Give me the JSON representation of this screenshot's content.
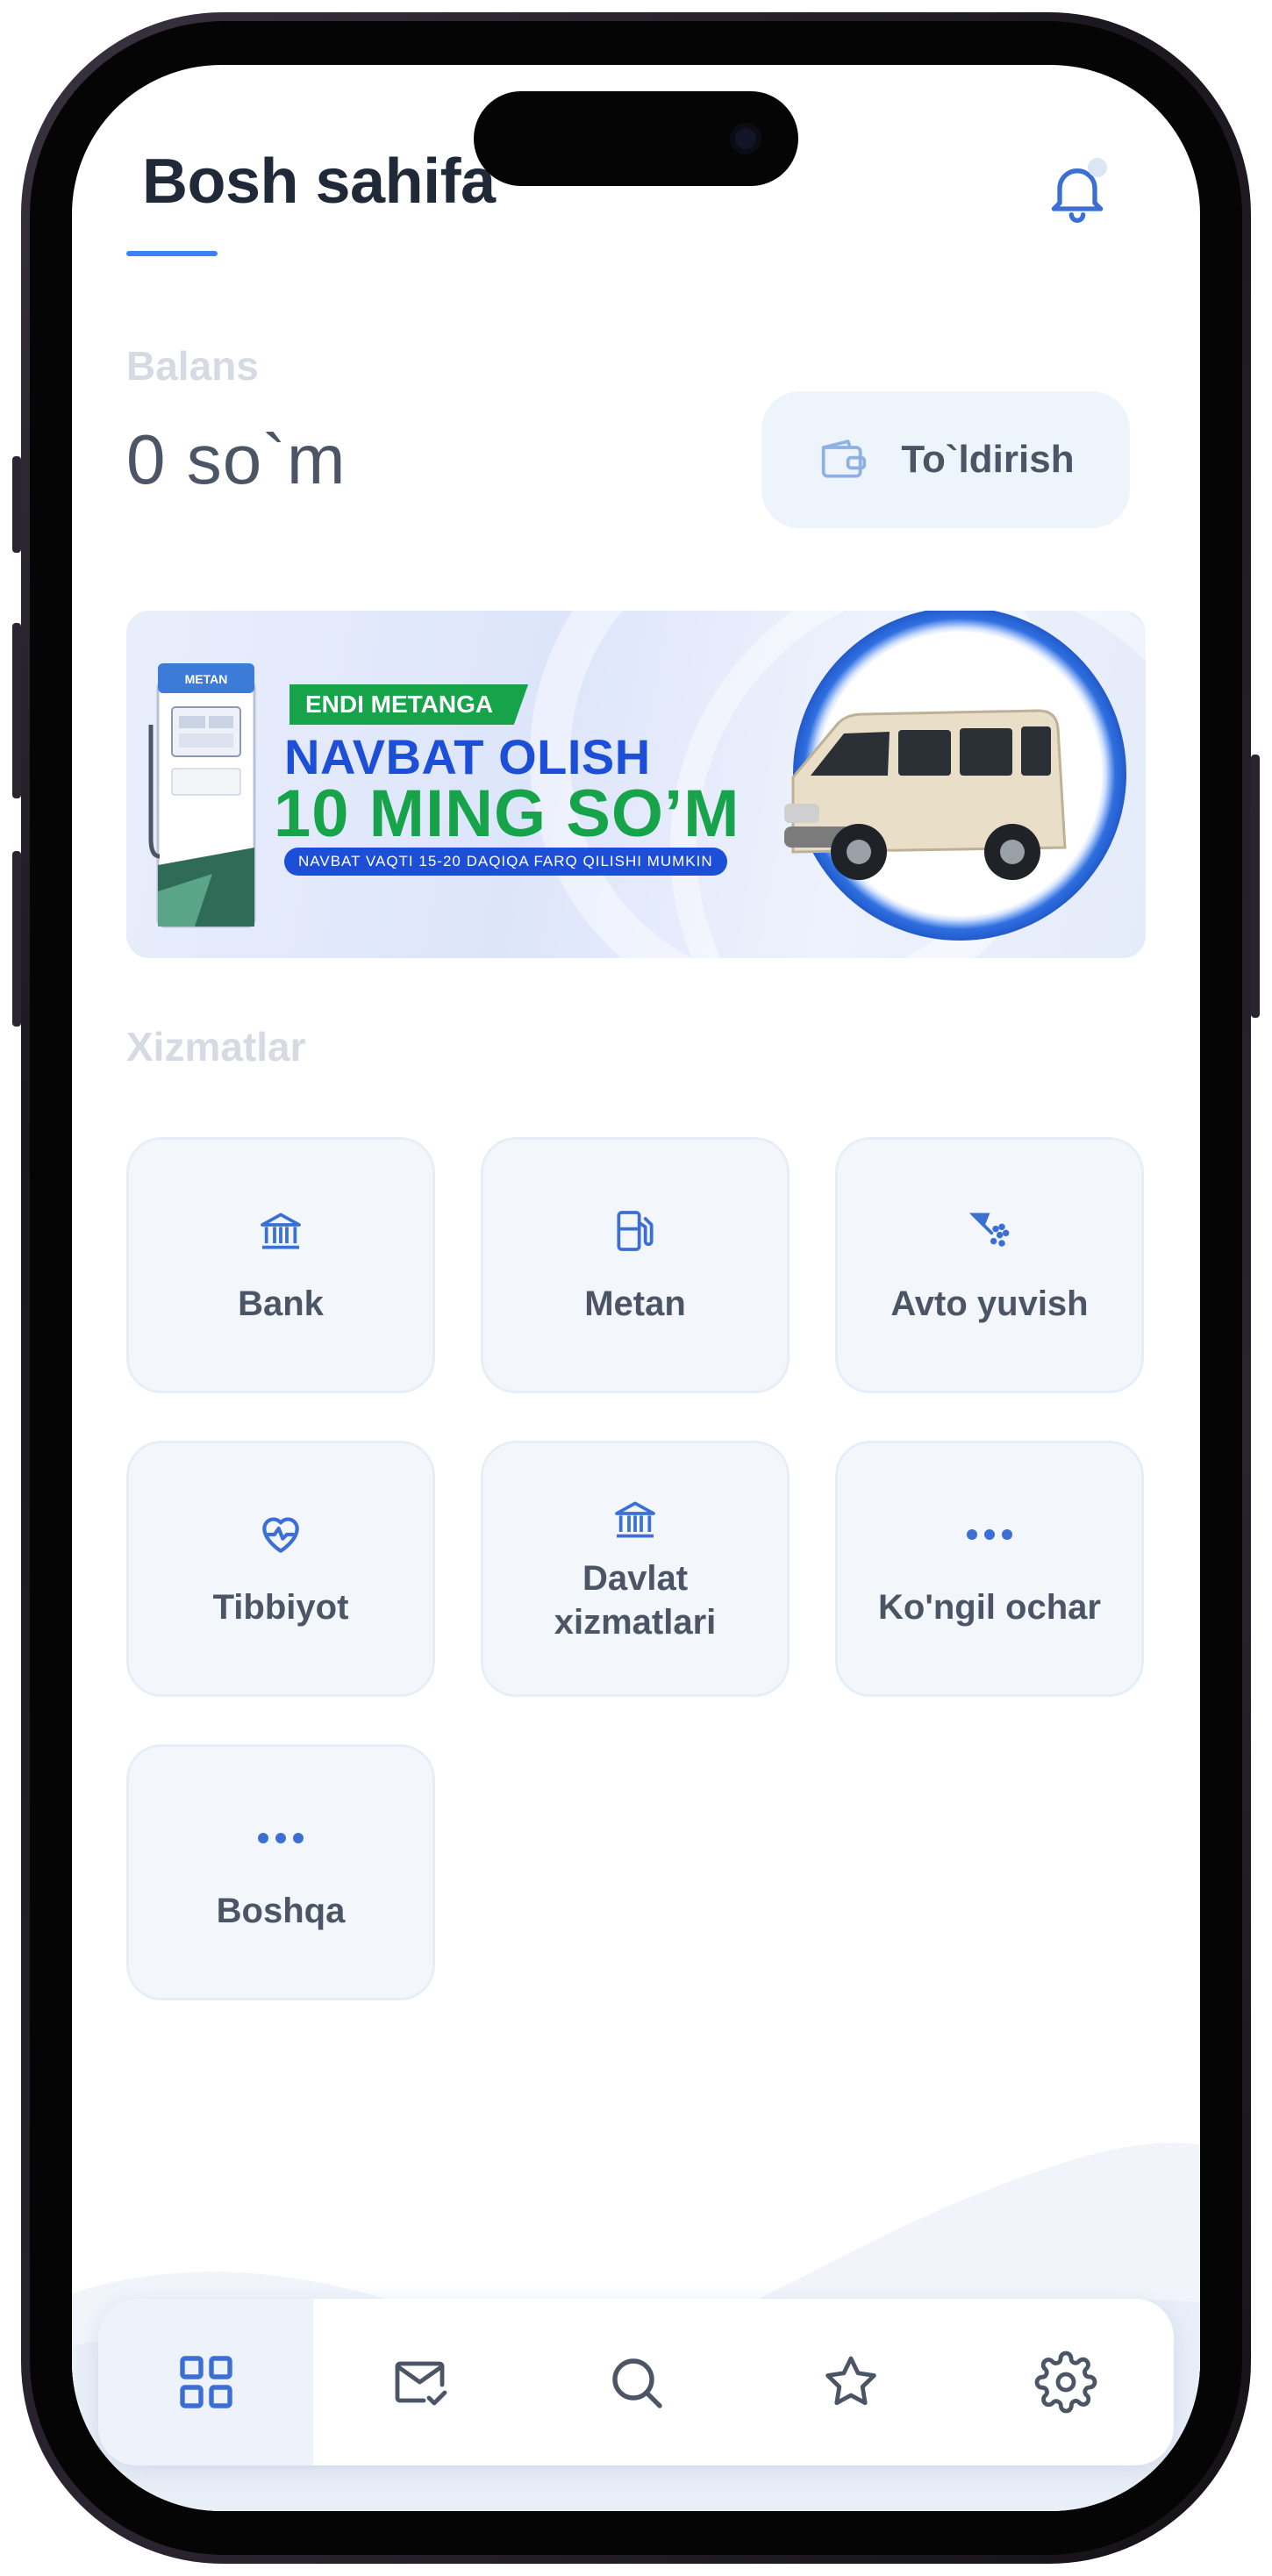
{
  "header": {
    "title": "Bosh sahifa",
    "notification_icon": "bell-icon"
  },
  "balance": {
    "label": "Balans",
    "value": "0 so`m",
    "topup_label": "To`ldirish",
    "topup_icon": "wallet-icon"
  },
  "banner": {
    "tag": "ENDI METANGA",
    "line1": "NAVBAT OLISH",
    "line2": "10 MING SO’M",
    "line3": "NAVBAT VAQTI 15-20 DAQIQA FARQ QILISHI MUMKIN",
    "pump_label": "METAN"
  },
  "services": {
    "title": "Xizmatlar",
    "items": [
      {
        "label": "Bank",
        "icon": "bank-icon"
      },
      {
        "label": "Metan",
        "icon": "fuel-pump-icon"
      },
      {
        "label": "Avto yuvish",
        "icon": "car-wash-icon"
      },
      {
        "label": "Tibbiyot",
        "icon": "heart-pulse-icon"
      },
      {
        "label": "Davlat xizmatlari",
        "icon": "bank-icon"
      },
      {
        "label": "Ko'ngil ochar",
        "icon": "more-dots-icon"
      },
      {
        "label": "Boshqa",
        "icon": "more-dots-icon"
      }
    ]
  },
  "nav": {
    "items": [
      {
        "name": "home",
        "icon": "grid-icon",
        "active": true
      },
      {
        "name": "messages",
        "icon": "mail-check-icon",
        "active": false
      },
      {
        "name": "search",
        "icon": "search-icon",
        "active": false
      },
      {
        "name": "favorites",
        "icon": "star-icon",
        "active": false
      },
      {
        "name": "settings",
        "icon": "gear-icon",
        "active": false
      }
    ]
  },
  "colors": {
    "accent": "#3b82f6",
    "icon": "#3b6fd4",
    "text": "#4b5565",
    "tile_bg": "#f3f7fc"
  }
}
